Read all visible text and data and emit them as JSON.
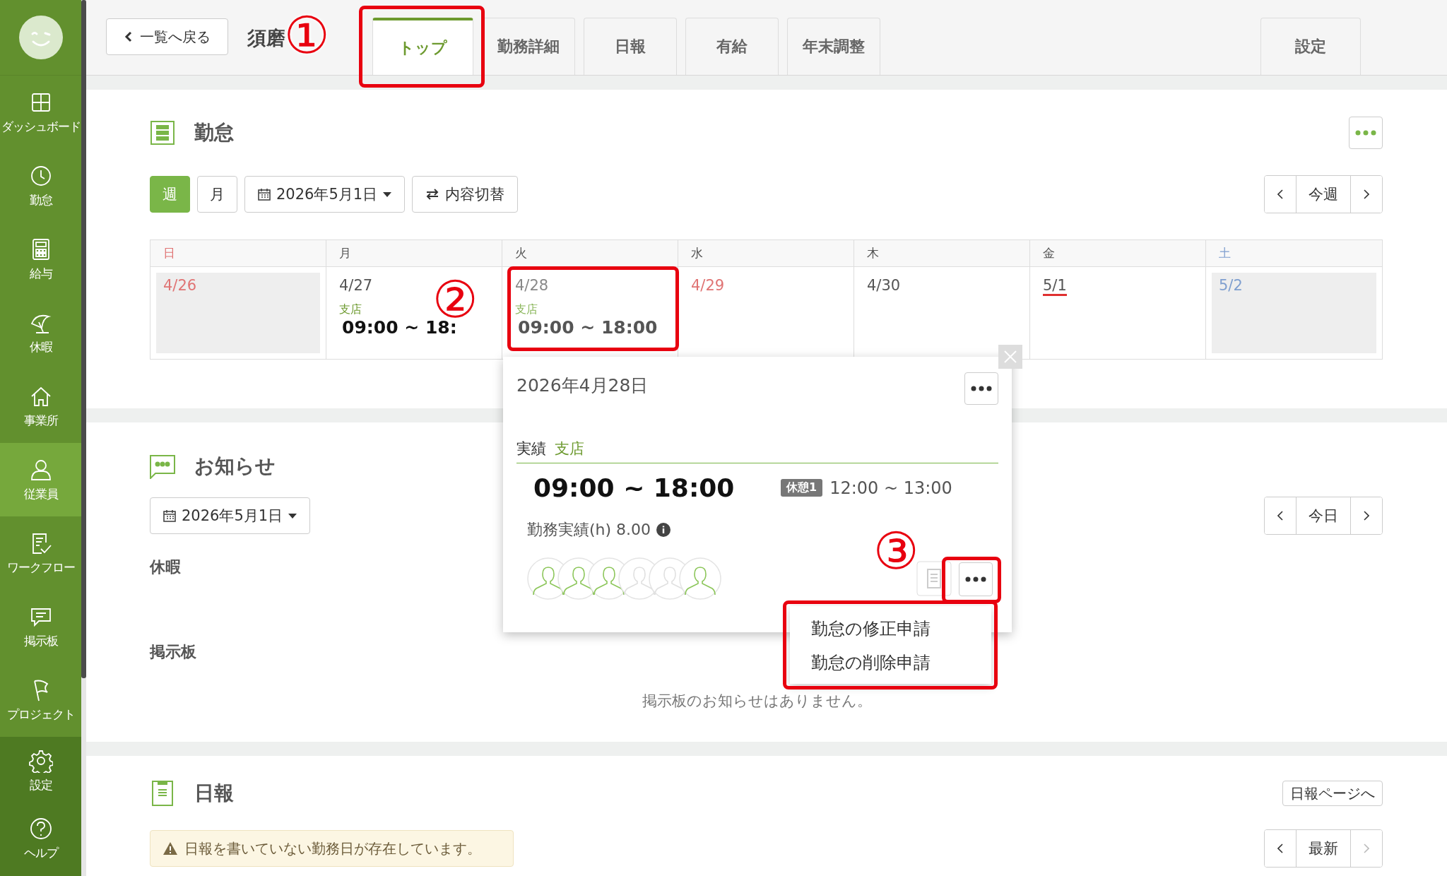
{
  "sidebar": {
    "items": [
      {
        "label": "ダッシュボード",
        "selected": false
      },
      {
        "label": "勤怠",
        "selected": false
      },
      {
        "label": "給与",
        "selected": false
      },
      {
        "label": "休暇",
        "selected": false
      },
      {
        "label": "事業所",
        "selected": false
      },
      {
        "label": "従業員",
        "selected": true
      },
      {
        "label": "ワークフロー",
        "selected": false
      },
      {
        "label": "掲示板",
        "selected": false
      },
      {
        "label": "プロジェクト",
        "selected": false
      }
    ],
    "bottom_items": [
      {
        "label": "設定"
      },
      {
        "label": "ヘルプ"
      }
    ]
  },
  "header": {
    "back_button": "一覧へ戻る",
    "employee_name": "須磨",
    "tabs": [
      {
        "label": "トップ",
        "selected": true
      },
      {
        "label": "勤務詳細",
        "selected": false
      },
      {
        "label": "日報",
        "selected": false
      },
      {
        "label": "有給",
        "selected": false
      },
      {
        "label": "年末調整",
        "selected": false
      }
    ],
    "settings_tab": "設定"
  },
  "attendance": {
    "title": "勤怠",
    "view_buttons": [
      {
        "label": "週",
        "selected": true
      },
      {
        "label": "月",
        "selected": false
      }
    ],
    "date_picker": "2026年5月1日",
    "switch_button": "内容切替",
    "nav": {
      "label": "今週",
      "next_disabled": false
    },
    "weekdays": [
      {
        "label": "日",
        "kind": "sunday"
      },
      {
        "label": "月",
        "kind": "weekday"
      },
      {
        "label": "火",
        "kind": "weekday"
      },
      {
        "label": "水",
        "kind": "weekday"
      },
      {
        "label": "木",
        "kind": "weekday"
      },
      {
        "label": "金",
        "kind": "weekday"
      },
      {
        "label": "土",
        "kind": "saturday"
      }
    ],
    "days": [
      {
        "date": "4/26",
        "kind": "sunday",
        "selected": false,
        "today": false
      },
      {
        "date": "4/27",
        "kind": "weekday",
        "selected": false,
        "today": false,
        "place": "支店",
        "time": "09:00 ~ 18:"
      },
      {
        "date": "4/28",
        "kind": "weekday",
        "selected": true,
        "today": false,
        "place": "支店",
        "time": "09:00 ~ 18:00"
      },
      {
        "date": "4/29",
        "kind": "holiday",
        "selected": false,
        "today": false
      },
      {
        "date": "4/30",
        "kind": "weekday",
        "selected": false,
        "today": false
      },
      {
        "date": "5/1",
        "kind": "weekday",
        "selected": false,
        "today": true
      },
      {
        "date": "5/2",
        "kind": "saturday",
        "selected": false,
        "today": false
      }
    ]
  },
  "popup": {
    "date": "2026年4月28日",
    "section_label": "実績",
    "place": "支店",
    "time": "09:00 ~ 18:00",
    "break_badge": "休憩1",
    "break_time": "12:00 ~ 13:00",
    "hours_label": "勤務実績(h) 8.00",
    "approvers": [
      {
        "active": true
      },
      {
        "active": true
      },
      {
        "active": true
      },
      {
        "active": false
      },
      {
        "active": false
      },
      {
        "active": true
      }
    ],
    "menu": [
      "勤怠の修正申請",
      "勤怠の削除申請"
    ]
  },
  "notices": {
    "title": "お知らせ",
    "date_picker": "2026年5月1日",
    "nav": {
      "label": "今日",
      "next_disabled": false
    },
    "sections": [
      "休暇",
      "掲示板"
    ],
    "empty_message": "掲示板のお知らせはありません。"
  },
  "daily_report": {
    "title": "日報",
    "page_button": "日報ページへ",
    "warning": "日報を書いていない勤務日が存在しています。",
    "nav": {
      "label": "最新",
      "next_disabled": true
    }
  },
  "annotations": [
    "①",
    "②",
    "③"
  ]
}
